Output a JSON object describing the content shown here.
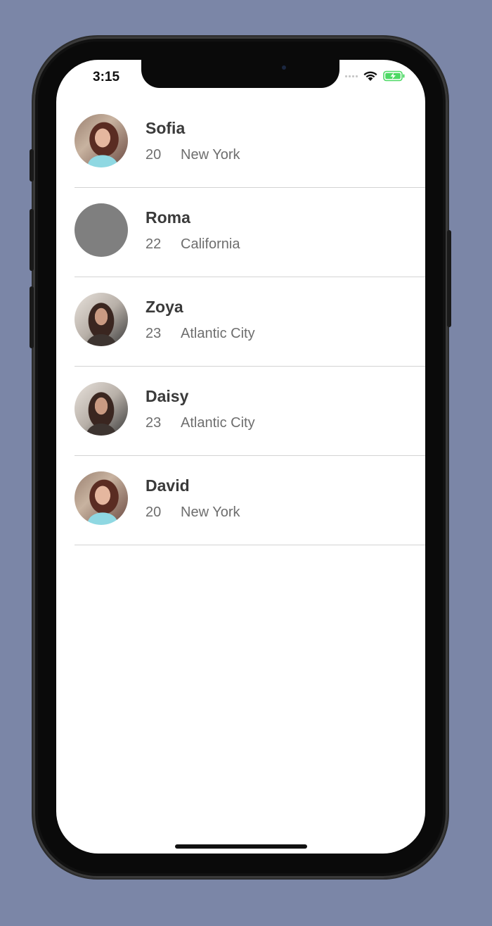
{
  "status_bar": {
    "time": "3:15",
    "icons": [
      "cellular-dots-icon",
      "wifi-icon",
      "battery-charging-icon"
    ],
    "battery_color": "#4cd964"
  },
  "contacts": [
    {
      "name": "Sofia",
      "age": "20",
      "city": "New York",
      "avatar": "photo"
    },
    {
      "name": "Roma",
      "age": "22",
      "city": "California",
      "avatar": "placeholder"
    },
    {
      "name": "Zoya",
      "age": "23",
      "city": "Atlantic City",
      "avatar": "photo"
    },
    {
      "name": "Daisy",
      "age": "23",
      "city": "Atlantic City",
      "avatar": "photo"
    },
    {
      "name": "David",
      "age": "20",
      "city": "New York",
      "avatar": "photo"
    }
  ]
}
